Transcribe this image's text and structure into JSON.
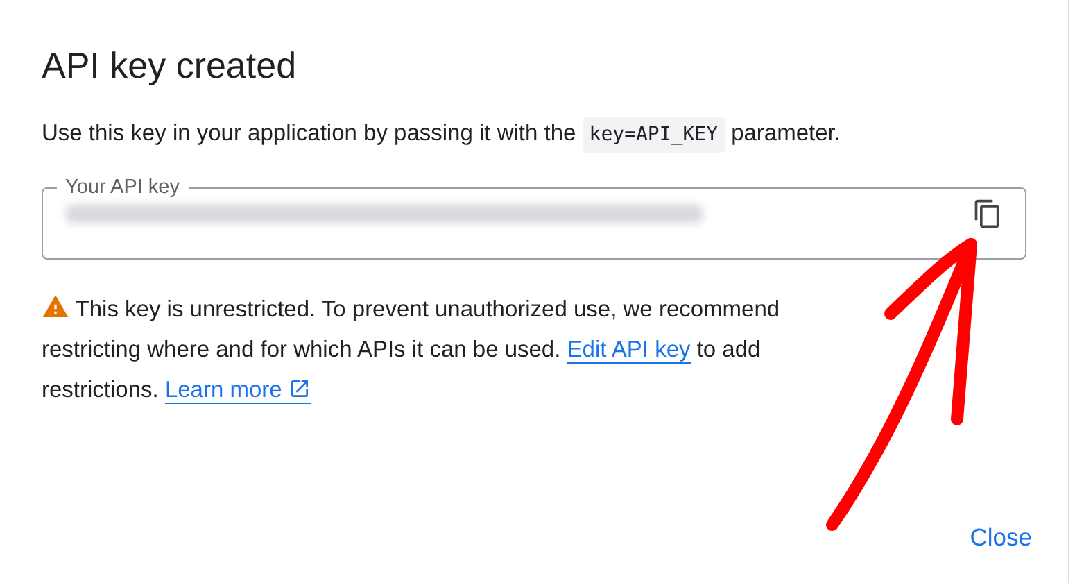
{
  "dialog": {
    "title": "API key created",
    "intro": {
      "before": "Use this key in your application by passing it with the",
      "code": "key=API_KEY",
      "after": "parameter."
    },
    "key_field": {
      "label": "Your API key",
      "redacted": true
    },
    "warning": {
      "text": "This key is unrestricted. To prevent unauthorized use, we recommend restricting where and for which APIs it can be used.",
      "edit_link": "Edit API key",
      "middle": "to add restrictions.",
      "learn_link": "Learn more"
    },
    "buttons": [
      {
        "label": "Close"
      }
    ]
  }
}
